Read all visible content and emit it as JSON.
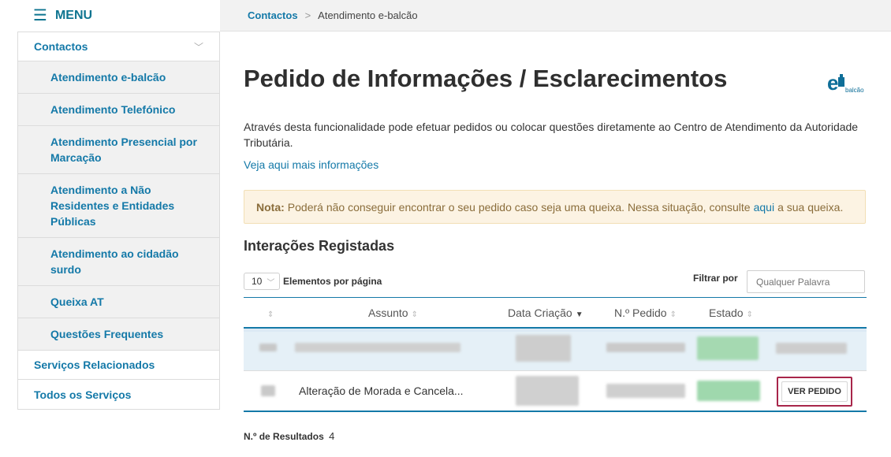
{
  "sidebar": {
    "menu_label": "MENU",
    "items": [
      {
        "label": "Contactos"
      },
      {
        "label": "Atendimento e-balcão"
      },
      {
        "label": "Atendimento Telefónico"
      },
      {
        "label": "Atendimento Presencial por Marcação"
      },
      {
        "label": "Atendimento a Não Residentes e Entidades Públicas"
      },
      {
        "label": "Atendimento ao cidadão surdo"
      },
      {
        "label": "Queixa AT"
      },
      {
        "label": "Questões Frequentes"
      },
      {
        "label": "Serviços Relacionados"
      },
      {
        "label": "Todos os Serviços"
      }
    ]
  },
  "breadcrumb": {
    "parent": "Contactos",
    "separator": ">",
    "current": "Atendimento e-balcão"
  },
  "main": {
    "title": "Pedido de Informações / Esclarecimentos",
    "logo_text": "balcão",
    "description": "Através desta funcionalidade pode efetuar pedidos ou colocar questões diretamente ao Centro de Atendimento da Autoridade Tributária.",
    "more_info_link": "Veja aqui mais informações",
    "note": {
      "label": "Nota:",
      "text_before": "Poderá não conseguir encontrar o seu pedido caso seja uma queixa. Nessa situação, consulte",
      "link": "aqui",
      "text_after": "a sua queixa."
    },
    "section_title": "Interações Registadas"
  },
  "table_controls": {
    "page_size": "10",
    "page_size_label": "Elementos por página",
    "filter_label": "Filtrar por",
    "filter_placeholder": "Qualquer Palavra"
  },
  "table": {
    "columns": [
      "Assunto",
      "Data Criação",
      "N.º Pedido",
      "Estado"
    ],
    "rows": [
      {
        "assunto": "",
        "action": ""
      },
      {
        "assunto": "Alteração de Morada e Cancela...",
        "action": "VER PEDIDO"
      }
    ]
  },
  "results": {
    "label": "N.º de Resultados",
    "count": "4"
  },
  "colors": {
    "accent": "#1479a8",
    "highlight_border": "#a8264a",
    "note_bg": "#fcf3e3",
    "status_green": "#8fdca0"
  }
}
